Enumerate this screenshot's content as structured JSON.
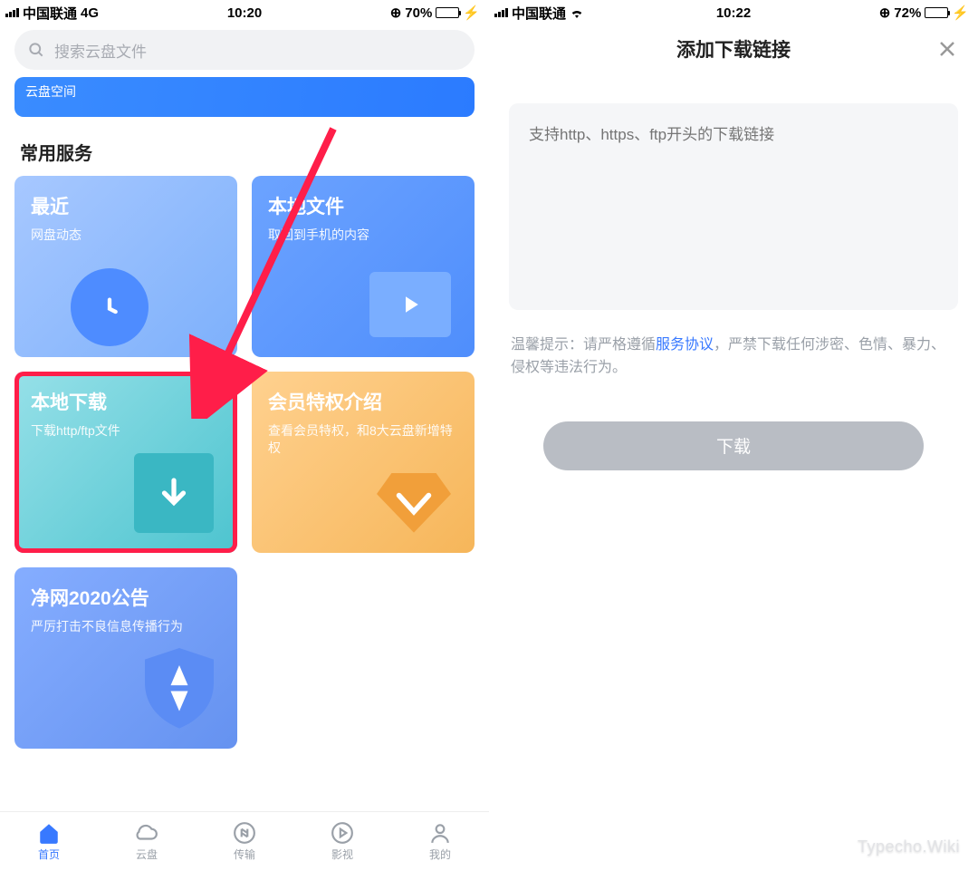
{
  "left": {
    "status": {
      "carrier": "中国联通",
      "net": "4G",
      "time": "10:20",
      "battery": "70%",
      "battery_fill": 70
    },
    "search_placeholder": "搜索云盘文件",
    "banner_text": "云盘空间",
    "section": "常用服务",
    "cards": {
      "recent": {
        "title": "最近",
        "sub": "网盘动态"
      },
      "local": {
        "title": "本地文件",
        "sub": "取回到手机的内容"
      },
      "download": {
        "title": "本地下载",
        "sub": "下载http/ftp文件"
      },
      "vip": {
        "title": "会员特权介绍",
        "sub": "查看会员特权，和8大云盘新增特权"
      },
      "notice": {
        "title": "净网2020公告",
        "sub": "严厉打击不良信息传播行为"
      }
    },
    "tabs": [
      "首页",
      "云盘",
      "传输",
      "影视",
      "我的"
    ]
  },
  "right": {
    "status": {
      "carrier": "中国联通",
      "time": "10:22",
      "battery": "72%",
      "battery_fill": 72
    },
    "title": "添加下载链接",
    "placeholder": "支持http、https、ftp开头的下载链接",
    "hint_pre": "温馨提示：请严格遵循",
    "hint_link": "服务协议",
    "hint_post": "，严禁下载任何涉密、色情、暴力、侵权等违法行为。",
    "button": "下载"
  },
  "watermark": "Typecho.Wiki"
}
